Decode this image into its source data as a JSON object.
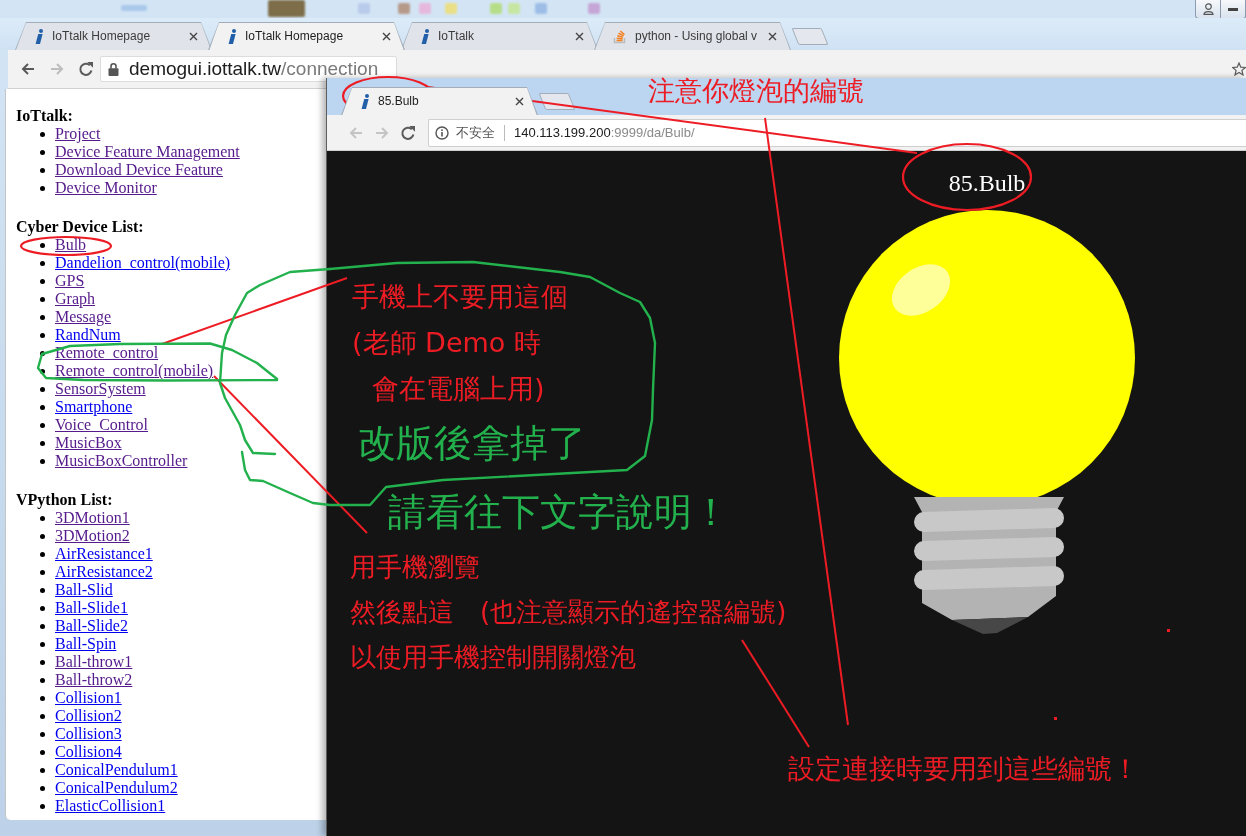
{
  "back_window": {
    "tabs": [
      {
        "kind": "info",
        "title": "IoTtalk Homepage",
        "selected": false
      },
      {
        "kind": "info",
        "title": "IoTtalk Homepage",
        "selected": true
      },
      {
        "kind": "info",
        "title": "IoTtalk",
        "selected": false
      },
      {
        "kind": "stack",
        "title": "python - Using global v",
        "selected": false
      }
    ],
    "address": {
      "host": "demogui.iottalk.tw",
      "path": "/connection"
    },
    "sections": [
      {
        "heading": "IoTtalk:",
        "links": [
          {
            "label": "Project",
            "visited": true
          },
          {
            "label": "Device Feature Management",
            "visited": true
          },
          {
            "label": "Download Device Feature",
            "visited": true
          },
          {
            "label": "Device Monitor",
            "visited": true
          }
        ]
      },
      {
        "heading": "Cyber Device List:",
        "links": [
          {
            "label": "Bulb",
            "visited": true
          },
          {
            "label": "Dandelion_control(mobile)",
            "visited": false
          },
          {
            "label": "GPS",
            "visited": true
          },
          {
            "label": "Graph",
            "visited": true
          },
          {
            "label": "Message",
            "visited": true
          },
          {
            "label": "RandNum",
            "visited": false
          },
          {
            "label": "Remote_control",
            "visited": true
          },
          {
            "label": "Remote_control(mobile)",
            "visited": true
          },
          {
            "label": "SensorSystem",
            "visited": true
          },
          {
            "label": "Smartphone",
            "visited": false
          },
          {
            "label": "Voice_Control",
            "visited": true
          },
          {
            "label": "MusicBox",
            "visited": true
          },
          {
            "label": "MusicBoxController",
            "visited": true
          }
        ]
      },
      {
        "heading": "VPython List:",
        "links": [
          {
            "label": "3DMotion1",
            "visited": true
          },
          {
            "label": "3DMotion2",
            "visited": true
          },
          {
            "label": "AirResistance1",
            "visited": false
          },
          {
            "label": "AirResistance2",
            "visited": false
          },
          {
            "label": "Ball-Slid",
            "visited": false
          },
          {
            "label": "Ball-Slide1",
            "visited": false
          },
          {
            "label": "Ball-Slide2",
            "visited": false
          },
          {
            "label": "Ball-Spin",
            "visited": false
          },
          {
            "label": "Ball-throw1",
            "visited": true
          },
          {
            "label": "Ball-throw2",
            "visited": true
          },
          {
            "label": "Collision1",
            "visited": false
          },
          {
            "label": "Collision2",
            "visited": false
          },
          {
            "label": "Collision3",
            "visited": false
          },
          {
            "label": "Collision4",
            "visited": false
          },
          {
            "label": "ConicalPendulum1",
            "visited": false
          },
          {
            "label": "ConicalPendulum2",
            "visited": false
          },
          {
            "label": "ElasticCollision1",
            "visited": false
          }
        ]
      }
    ]
  },
  "front_window": {
    "tabs": [
      {
        "kind": "info",
        "title": "85.Bulb",
        "selected": true
      }
    ],
    "address": {
      "security": "不安全",
      "host": "140.113.199.200",
      "path": ":9999/da/Bulb/"
    },
    "device_label": "85.Bulb",
    "bulb": {
      "on": true
    }
  },
  "annotations": [
    {
      "lines": [
        "注意你燈泡的編號"
      ],
      "color": "#ed1c24"
    },
    {
      "lines": [
        "手機上不要用這個",
        "(老師 Demo 時",
        "會在電腦上用)"
      ],
      "color": "#ed1c24"
    },
    {
      "lines": [
        "改版後拿掉了"
      ],
      "color": "#22b14c"
    },
    {
      "lines": [
        "請看往下文字說明！"
      ],
      "color": "#22b14c"
    },
    {
      "lines": [
        "用手機瀏覽",
        "然後點這　(也注意顯示的遙控器編號)",
        "以使用手機控制開關燈泡"
      ],
      "color": "#ed1c24"
    },
    {
      "lines": [
        "設定連接時要用到這些編號！"
      ],
      "color": "#ed1c24"
    }
  ]
}
